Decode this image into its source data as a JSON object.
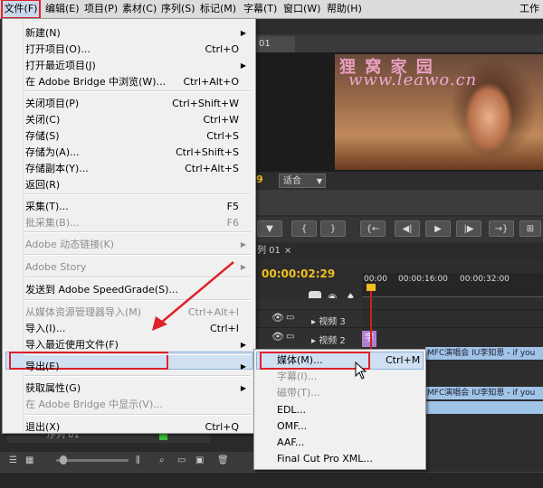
{
  "menubar": {
    "items": [
      "文件(F)",
      "编辑(E)",
      "项目(P)",
      "素材(C)",
      "序列(S)",
      "标记(M)",
      "字幕(T)",
      "窗口(W)",
      "帮助(H)"
    ],
    "right_label": "工作"
  },
  "monitor": {
    "tab_label": "01",
    "watermark_line1": "狸 窝 家 园",
    "watermark_line2": "www.leawo.cn",
    "timecode_partial": "9",
    "fit_label": "适合"
  },
  "timeline": {
    "tab_label": "列 01",
    "timecode": "00:00:02:29",
    "ruler_labels": [
      "00:00",
      "00:00:16:00",
      "00:00:32:00"
    ],
    "tracks": [
      "视频 3",
      "视频 2"
    ],
    "clip_purple_label": "字",
    "clip_text": "MFC演唱会 IU李知恩 - if you"
  },
  "left_panel": {
    "sequence_label": "序列 01"
  },
  "file_menu": {
    "items": [
      {
        "label": "新建(N)",
        "shortcut": "",
        "submenu": true,
        "disabled": false
      },
      {
        "label": "打开项目(O)...",
        "shortcut": "Ctrl+O",
        "submenu": false,
        "disabled": false
      },
      {
        "label": "打开最近项目(J)",
        "shortcut": "",
        "submenu": true,
        "disabled": false
      },
      {
        "label": "在 Adobe Bridge 中浏览(W)...",
        "shortcut": "Ctrl+Alt+O",
        "submenu": false,
        "disabled": false
      },
      {
        "label": "关闭项目(P)",
        "shortcut": "Ctrl+Shift+W",
        "submenu": false,
        "disabled": false
      },
      {
        "label": "关闭(C)",
        "shortcut": "Ctrl+W",
        "submenu": false,
        "disabled": false
      },
      {
        "label": "存储(S)",
        "shortcut": "Ctrl+S",
        "submenu": false,
        "disabled": false
      },
      {
        "label": "存储为(A)...",
        "shortcut": "Ctrl+Shift+S",
        "submenu": false,
        "disabled": false
      },
      {
        "label": "存储副本(Y)...",
        "shortcut": "Ctrl+Alt+S",
        "submenu": false,
        "disabled": false
      },
      {
        "label": "返回(R)",
        "shortcut": "",
        "submenu": false,
        "disabled": false
      },
      {
        "label": "采集(T)...",
        "shortcut": "F5",
        "submenu": false,
        "disabled": false
      },
      {
        "label": "批采集(B)...",
        "shortcut": "F6",
        "submenu": false,
        "disabled": true
      },
      {
        "label": "Adobe 动态链接(K)",
        "shortcut": "",
        "submenu": true,
        "disabled": true
      },
      {
        "label": "Adobe Story",
        "shortcut": "",
        "submenu": true,
        "disabled": true
      },
      {
        "label": "发送到 Adobe SpeedGrade(S)...",
        "shortcut": "",
        "submenu": false,
        "disabled": false
      },
      {
        "label": "从媒体资源管理器导入(M)",
        "shortcut": "Ctrl+Alt+I",
        "submenu": false,
        "disabled": true
      },
      {
        "label": "导入(I)...",
        "shortcut": "Ctrl+I",
        "submenu": false,
        "disabled": false
      },
      {
        "label": "导入最近使用文件(F)",
        "shortcut": "",
        "submenu": true,
        "disabled": false
      },
      {
        "label": "导出(E)",
        "shortcut": "",
        "submenu": true,
        "disabled": false
      },
      {
        "label": "获取属性(G)",
        "shortcut": "",
        "submenu": true,
        "disabled": false
      },
      {
        "label": "在 Adobe Bridge 中显示(V)...",
        "shortcut": "",
        "submenu": false,
        "disabled": true
      },
      {
        "label": "退出(X)",
        "shortcut": "Ctrl+Q",
        "submenu": false,
        "disabled": false
      }
    ]
  },
  "export_submenu": {
    "items": [
      {
        "label": "媒体(M)...",
        "shortcut": "Ctrl+M",
        "disabled": false
      },
      {
        "label": "字幕(I)...",
        "shortcut": "",
        "disabled": true
      },
      {
        "label": "磁带(T)...",
        "shortcut": "",
        "disabled": true
      },
      {
        "label": "EDL...",
        "shortcut": "",
        "disabled": false
      },
      {
        "label": "OMF...",
        "shortcut": "",
        "disabled": false
      },
      {
        "label": "AAF...",
        "shortcut": "",
        "disabled": false
      },
      {
        "label": "Final Cut Pro XML...",
        "shortcut": "",
        "disabled": false
      }
    ]
  },
  "colors": {
    "highlight": "#cfe0f3",
    "annotation_red": "#e0202a",
    "timecode_yellow": "#f0c020"
  }
}
